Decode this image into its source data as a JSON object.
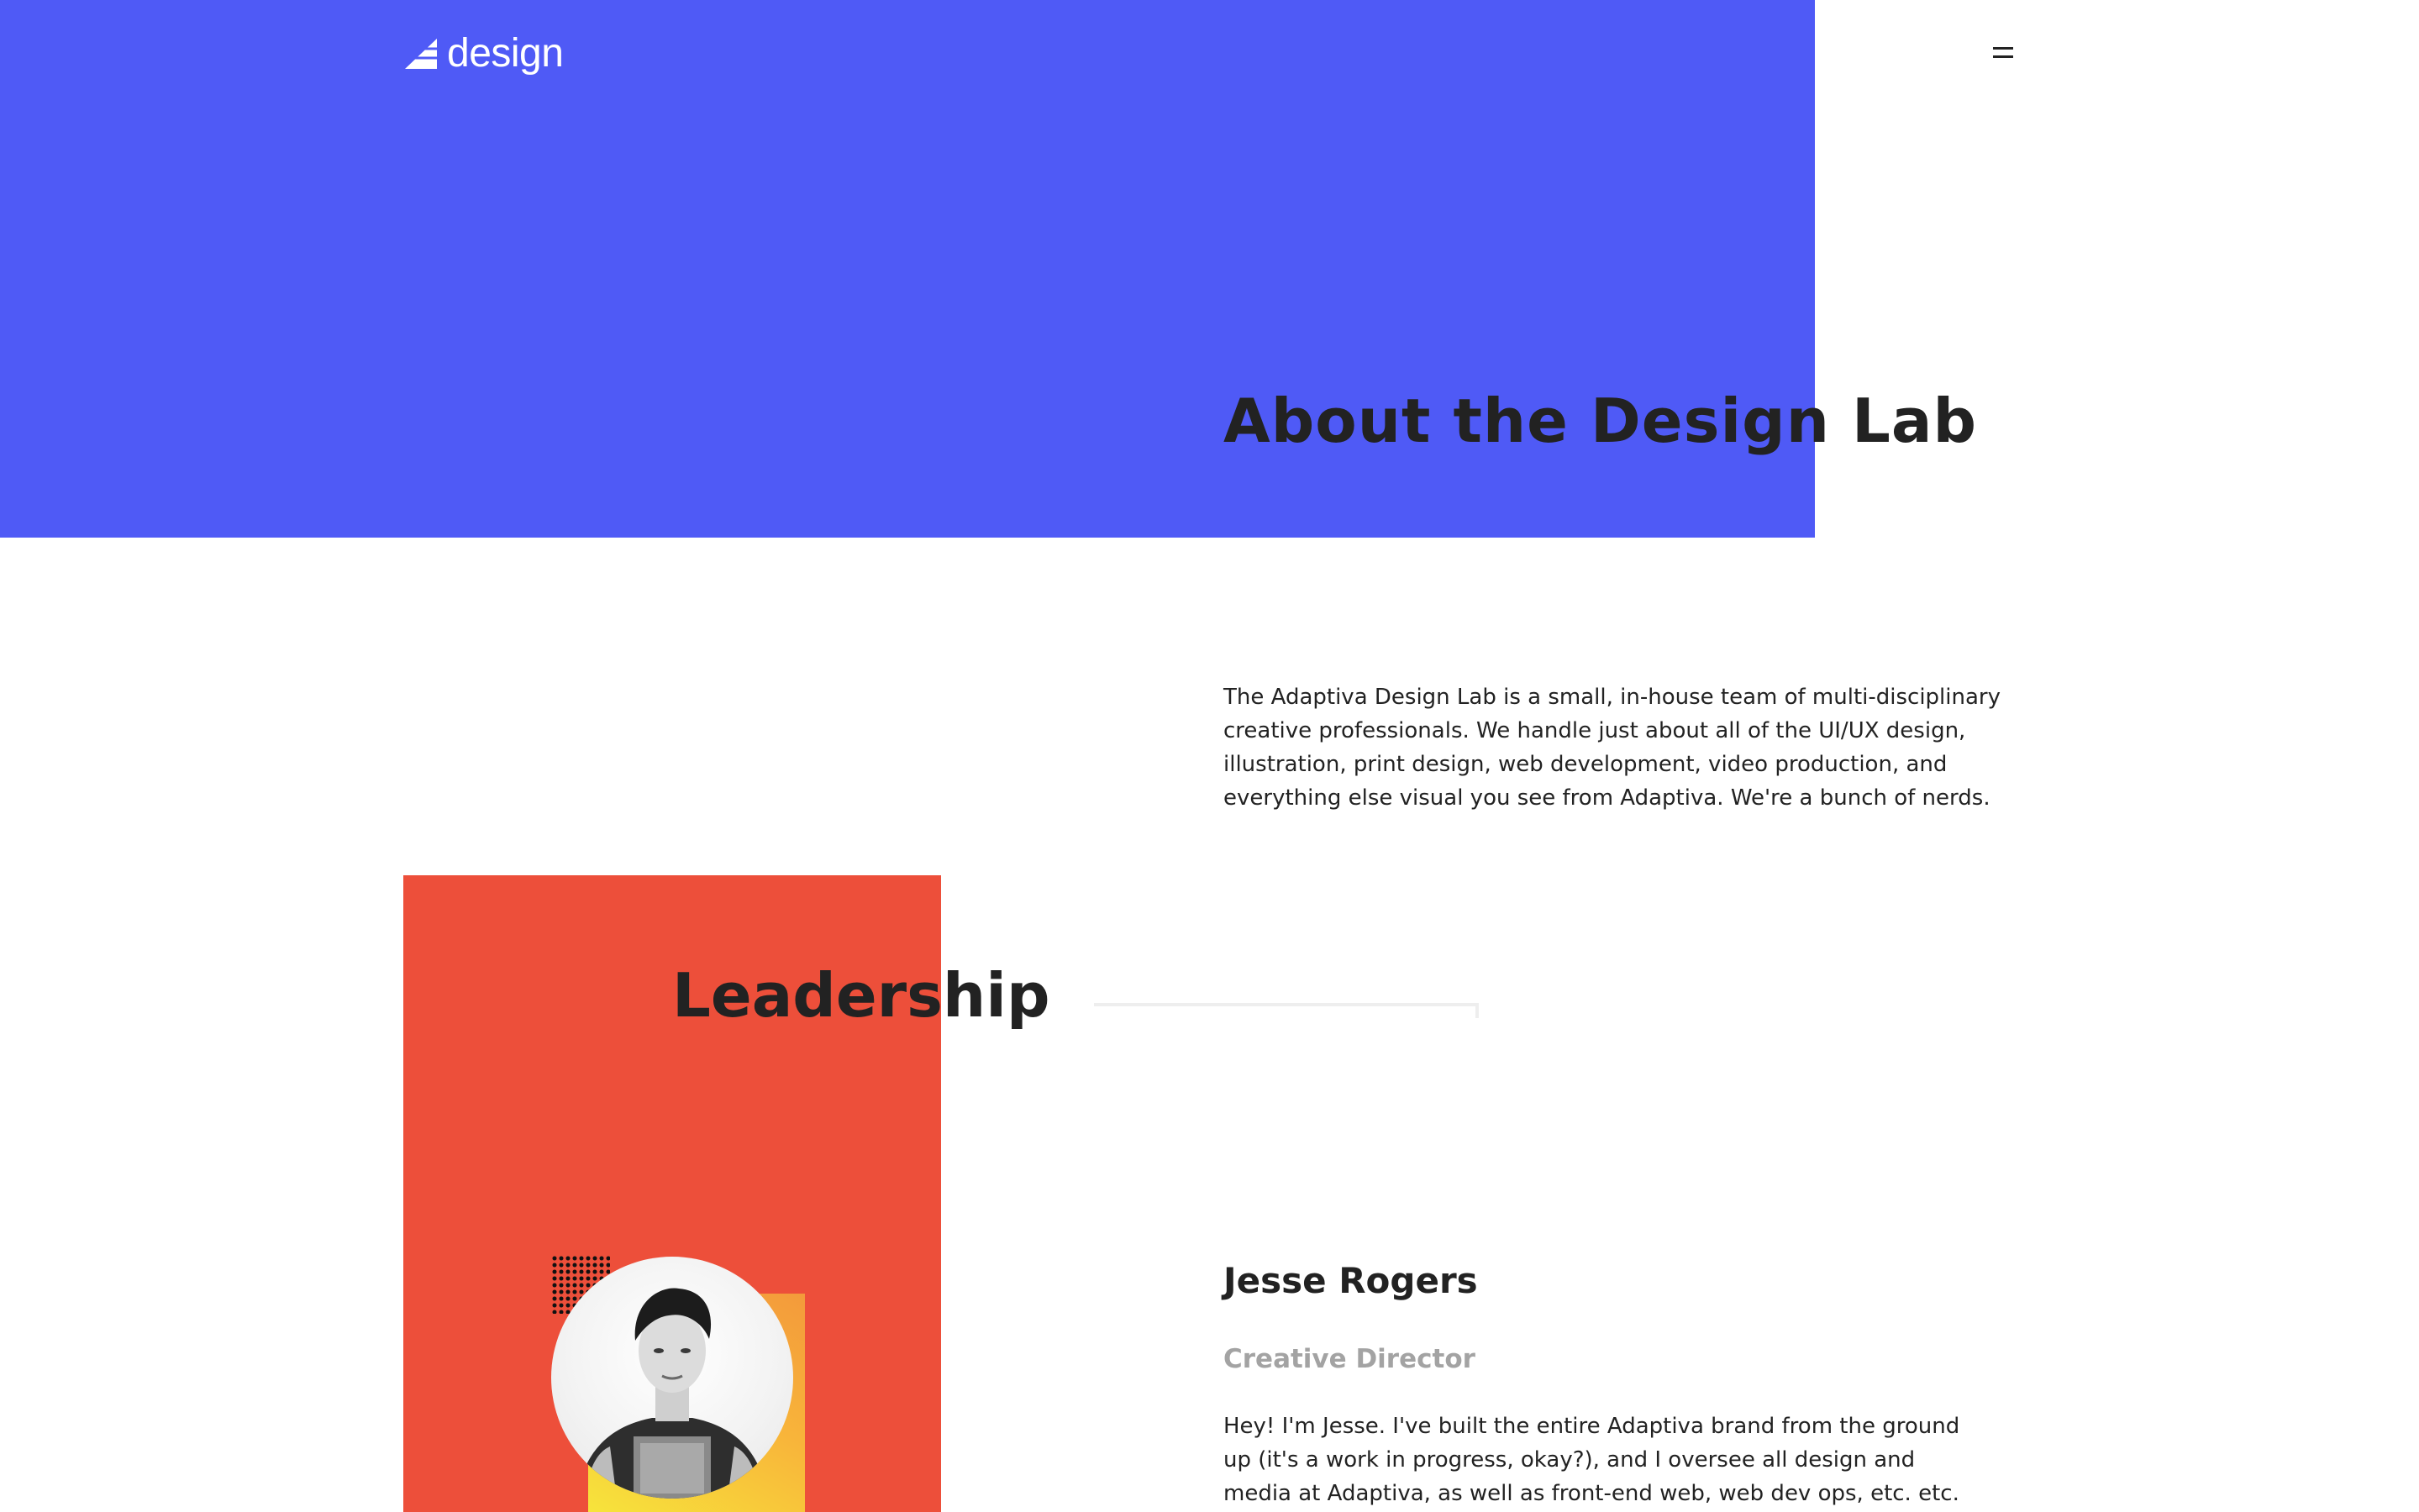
{
  "header": {
    "logo_text": "design",
    "logo_icon": "triangle-logo-icon",
    "menu_icon": "hamburger-menu-icon"
  },
  "about": {
    "title": "About the Design Lab",
    "paragraph": "The Adaptiva Design Lab is a small, in-house team of multi-disciplinary creative professionals. We handle just about all of the UI/UX design, illustration, print design, web development, video production, and everything else visual you see from Adaptiva. We're a bunch of nerds."
  },
  "leadership": {
    "title": "Leadership",
    "person": {
      "name": "Jesse Rogers",
      "role": "Creative Director",
      "bio": "Hey! I'm Jesse. I've built the entire Adaptiva brand from the ground up (it's a work in progress, okay?), and I oversee all design and media at Adaptiva, as well as front-end web, web dev ops, etc. etc. etc."
    }
  },
  "colors": {
    "hero_blue": "#4f5af6",
    "leadership_red": "#ed4f3a",
    "text_dark": "#222222",
    "text_muted": "#a3a3a3",
    "accent_yellow": "#f7e43b",
    "accent_orange": "#f39a3b"
  }
}
